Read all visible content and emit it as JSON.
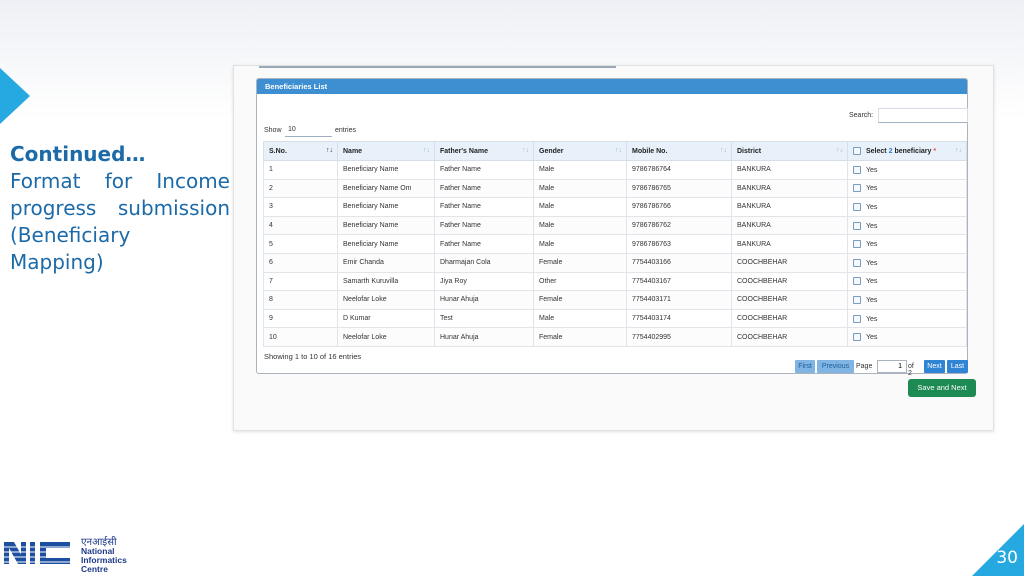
{
  "slide": {
    "heading": "Continued…",
    "body": "Format for Income progress submission (Beneficiary Mapping)",
    "page_number": "30"
  },
  "logo": {
    "hindi": "एनआईसी",
    "line1": "National",
    "line2": "Informatics",
    "line3": "Centre"
  },
  "colors": {
    "accent": "#26a9e0",
    "title_text": "#1c6aa8",
    "header_bar": "#3d8fd1",
    "save_button": "#1e8a53"
  },
  "app": {
    "panel_title": "Beneficiaries List",
    "search_label": "Search:",
    "show_label": "Show",
    "page_size": "10",
    "entries_label": "entries",
    "columns": {
      "sno": "S.No.",
      "name": "Name",
      "father": "Father's Name",
      "gender": "Gender",
      "mobile": "Mobile No.",
      "district": "District",
      "select_prefix": "Select",
      "select_count": "2",
      "select_suffix": "beneficiary",
      "required_mark": "*"
    },
    "rows": [
      {
        "sno": "1",
        "name": "Beneficiary Name",
        "father": "Father Name",
        "gender": "Male",
        "mobile": "9786786764",
        "district": "BANKURA",
        "select": "Yes"
      },
      {
        "sno": "2",
        "name": "Beneficiary Name Om",
        "father": "Father Name",
        "gender": "Male",
        "mobile": "9786786765",
        "district": "BANKURA",
        "select": "Yes"
      },
      {
        "sno": "3",
        "name": "Beneficiary Name",
        "father": "Father Name",
        "gender": "Male",
        "mobile": "9786786766",
        "district": "BANKURA",
        "select": "Yes"
      },
      {
        "sno": "4",
        "name": "Beneficiary Name",
        "father": "Father Name",
        "gender": "Male",
        "mobile": "9786786762",
        "district": "BANKURA",
        "select": "Yes"
      },
      {
        "sno": "5",
        "name": "Beneficiary Name",
        "father": "Father Name",
        "gender": "Male",
        "mobile": "9786786763",
        "district": "BANKURA",
        "select": "Yes"
      },
      {
        "sno": "6",
        "name": "Emir Chanda",
        "father": "Dharmajan Cola",
        "gender": "Female",
        "mobile": "7754403166",
        "district": "COOCHBEHAR",
        "select": "Yes"
      },
      {
        "sno": "7",
        "name": "Samarth Kuruvilla",
        "father": "Jiya Roy",
        "gender": "Other",
        "mobile": "7754403167",
        "district": "COOCHBEHAR",
        "select": "Yes"
      },
      {
        "sno": "8",
        "name": "Neelofar Loke",
        "father": "Hunar Ahuja",
        "gender": "Female",
        "mobile": "7754403171",
        "district": "COOCHBEHAR",
        "select": "Yes"
      },
      {
        "sno": "9",
        "name": "D Kumar",
        "father": "Test",
        "gender": "Male",
        "mobile": "7754403174",
        "district": "COOCHBEHAR",
        "select": "Yes"
      },
      {
        "sno": "10",
        "name": "Neelofar Loke",
        "father": "Hunar Ahuja",
        "gender": "Female",
        "mobile": "7754402995",
        "district": "COOCHBEHAR",
        "select": "Yes"
      }
    ],
    "footer_info": "Showing 1 to 10 of 16 entries",
    "pager": {
      "first": "First",
      "previous": "Previous",
      "page_word": "Page",
      "current_page": "1",
      "of_total": "of 2",
      "next": "Next",
      "last": "Last"
    },
    "save_button": "Save and Next"
  }
}
